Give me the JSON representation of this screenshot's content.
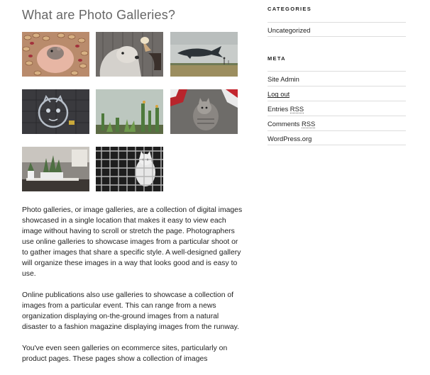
{
  "main": {
    "title": "What are Photo Galleries?",
    "gallery": [
      {
        "subject": "hands holding a hamster on peanuts"
      },
      {
        "subject": "shaggy dog with an ice cream cone"
      },
      {
        "subject": "whale sculpture flying over a field"
      },
      {
        "subject": "cat chalk drawing on pavement"
      },
      {
        "subject": "cacti against a pale sky"
      },
      {
        "subject": "cat between sneakers"
      },
      {
        "subject": "potted plants in a kitchen"
      },
      {
        "subject": "cat behind a wire fence"
      }
    ],
    "paragraphs": [
      "Photo galleries, or image galleries, are a collection of digital images showcased in a single location that makes it easy to view each image without having to scroll or stretch the page. Photographers use online galleries to showcase images from a particular shoot or to gather images that share a specific style. A well-designed gallery will organize these images in a way that looks good and is easy to use.",
      "Online publications also use galleries to showcase a collection of images from a particular event. This can range from a news organization displaying on-the-ground images from a natural disaster to a fashion magazine displaying images from the runway.",
      "You've even seen galleries on ecommerce sites, particularly on product pages. These pages show a collection of images"
    ]
  },
  "sidebar": {
    "categories": {
      "title": "CATEGORIES",
      "items": [
        {
          "label": "Uncategorized"
        }
      ]
    },
    "meta": {
      "title": "META",
      "items": [
        {
          "label": "Site Admin"
        },
        {
          "label": "Log out"
        },
        {
          "prefix": "Entries ",
          "abbr": "RSS"
        },
        {
          "prefix": "Comments ",
          "abbr": "RSS"
        },
        {
          "label": "WordPress.org"
        }
      ]
    }
  }
}
